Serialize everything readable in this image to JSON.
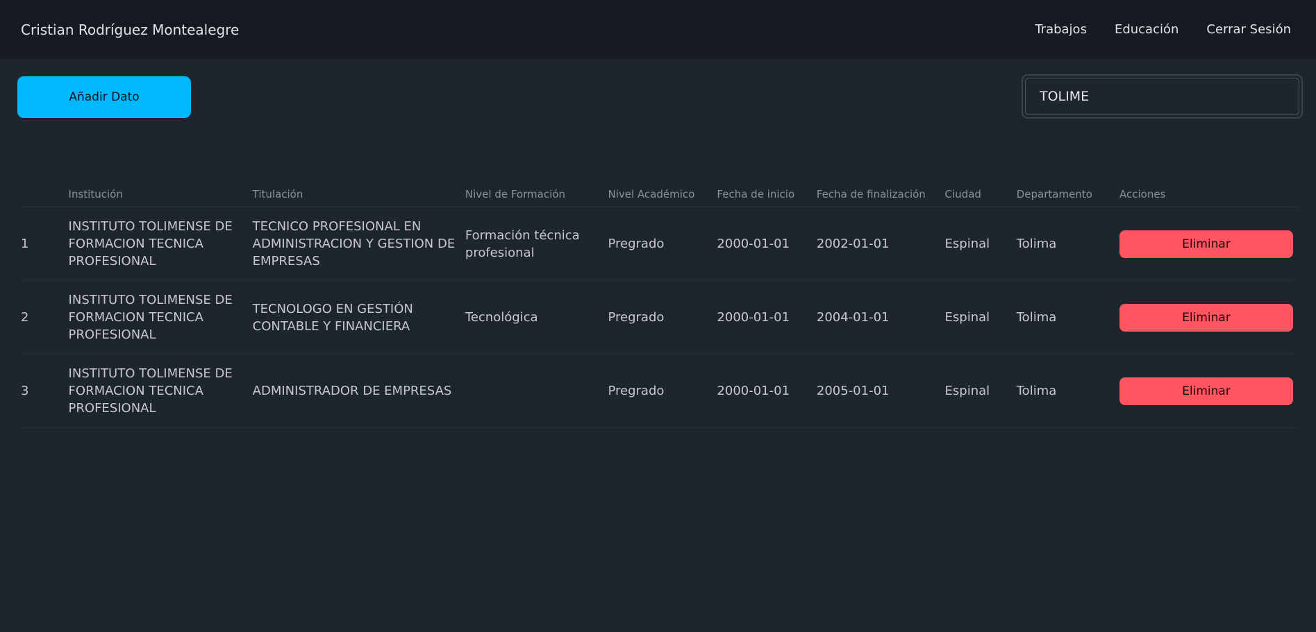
{
  "navbar": {
    "brand": "Cristian Rodríguez Montealegre",
    "links": [
      "Trabajos",
      "Educación",
      "Cerrar Sesión"
    ]
  },
  "toolbar": {
    "add_label": "Añadir Dato",
    "search_value": "TOLIME"
  },
  "table": {
    "headers": [
      "",
      "Institución",
      "Titulación",
      "Nivel de Formación",
      "Nivel Académico",
      "Fecha de inicio",
      "Fecha de finalización",
      "Ciudad",
      "Departamento",
      "Acciones"
    ],
    "rows": [
      {
        "index": "1",
        "institucion": "INSTITUTO TOLIMENSE DE FORMACION TECNICA PROFESIONAL",
        "titulacion": "TECNICO PROFESIONAL EN ADMINISTRACION Y GESTION DE EMPRESAS",
        "nivel_formacion": "Formación técnica profesional",
        "nivel_academico": "Pregrado",
        "fecha_inicio": "2000-01-01",
        "fecha_fin": "2002-01-01",
        "ciudad": "Espinal",
        "departamento": "Tolima",
        "action_label": "Eliminar"
      },
      {
        "index": "2",
        "institucion": "INSTITUTO TOLIMENSE DE FORMACION TECNICA PROFESIONAL",
        "titulacion": "TECNOLOGO EN GESTIÓN CONTABLE Y FINANCIERA",
        "nivel_formacion": "Tecnológica",
        "nivel_academico": "Pregrado",
        "fecha_inicio": "2000-01-01",
        "fecha_fin": "2004-01-01",
        "ciudad": "Espinal",
        "departamento": "Tolima",
        "action_label": "Eliminar"
      },
      {
        "index": "3",
        "institucion": "INSTITUTO TOLIMENSE DE FORMACION TECNICA PROFESIONAL",
        "titulacion": "ADMINISTRADOR DE EMPRESAS",
        "nivel_formacion": "",
        "nivel_academico": "Pregrado",
        "fecha_inicio": "2000-01-01",
        "fecha_fin": "2005-01-01",
        "ciudad": "Espinal",
        "departamento": "Tolima",
        "action_label": "Eliminar"
      }
    ]
  },
  "colors": {
    "background": "#1f252d",
    "navbar": "#161b21",
    "primary": "#00b8ff",
    "danger": "#ff5561"
  }
}
